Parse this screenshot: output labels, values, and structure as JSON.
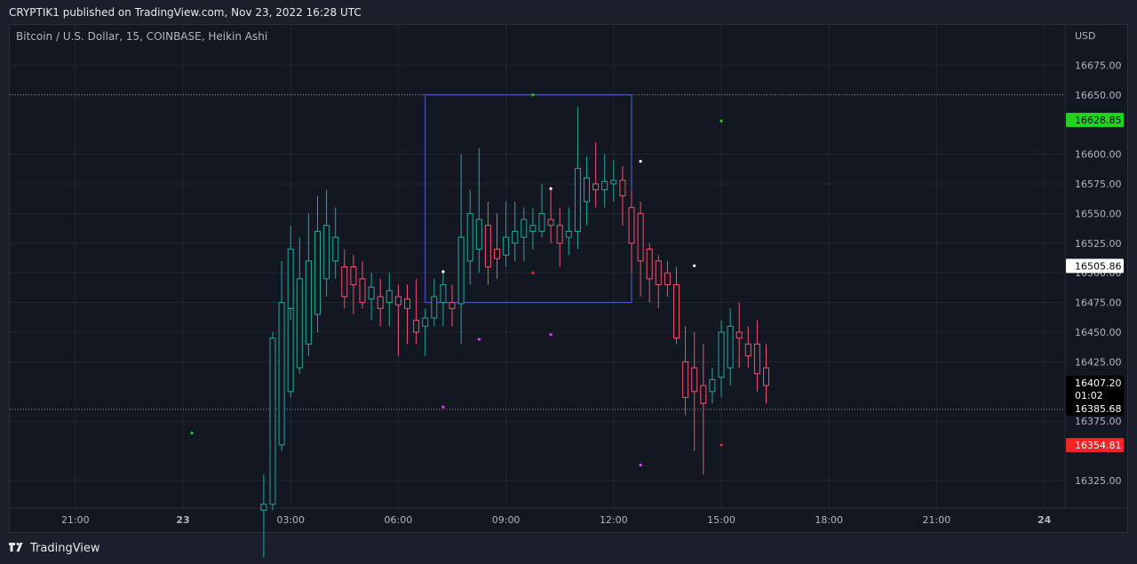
{
  "header": {
    "published": "CRYPTIK1 published on TradingView.com, Nov 23, 2022 16:28 UTC"
  },
  "symbol_label": "Bitcoin / U.S. Dollar, 15, COINBASE, Heikin Ashi",
  "footer": {
    "brand": "TradingView",
    "logo_icon": "tradingview-logo-icon"
  },
  "colors": {
    "background": "#131722",
    "grid": "#22262f",
    "up": "#26a69a",
    "down": "#ef5370",
    "box": "#4c64d8",
    "dotted_line": "#8a8fa0",
    "green_tag": "#1fd31f",
    "red_tag": "#f02525",
    "white_tag": "#ffffff",
    "dark_tag": "#000000"
  },
  "chart_data": {
    "type": "candlestick",
    "style": "Heikin Ashi",
    "currency": "USD",
    "ylim": [
      16300,
      16700
    ],
    "y_ticks": [
      "16325.00",
      "16375.00",
      "16425.00",
      "16450.00",
      "16475.00",
      "16500.00",
      "16525.00",
      "16550.00",
      "16575.00",
      "16600.00",
      "16650.00",
      "16675.00"
    ],
    "x_ticks": [
      {
        "label": "21:00",
        "hour": -3
      },
      {
        "label": "23",
        "hour": 0,
        "bold": true
      },
      {
        "label": "03:00",
        "hour": 3
      },
      {
        "label": "06:00",
        "hour": 6
      },
      {
        "label": "09:00",
        "hour": 9
      },
      {
        "label": "12:00",
        "hour": 12
      },
      {
        "label": "15:00",
        "hour": 15
      },
      {
        "label": "18:00",
        "hour": 18
      },
      {
        "label": "21:00",
        "hour": 21
      },
      {
        "label": "24",
        "hour": 24,
        "bold": true
      }
    ],
    "candles": [
      [
        "2:15",
        16300,
        16330,
        16260,
        16305
      ],
      [
        "2:30",
        16305,
        16450,
        16300,
        16445
      ],
      [
        "2:45",
        16355,
        16510,
        16350,
        16475
      ],
      [
        "3:00",
        16400,
        16490,
        16395,
        16470
      ],
      [
        "3:15",
        16420,
        16530,
        16415,
        16495
      ],
      [
        "3:30",
        16440,
        16550,
        16430,
        16510
      ],
      [
        "3:45",
        16465,
        16565,
        16450,
        16535
      ],
      [
        "3:00",
        16470,
        16540,
        16460,
        16520
      ],
      [
        "4:00",
        16495,
        16570,
        16480,
        16540
      ],
      [
        "4:15",
        16510,
        16555,
        16495,
        16530
      ],
      [
        "4:30",
        16505,
        16520,
        16470,
        16480
      ],
      [
        "4:45",
        16505,
        16515,
        16465,
        16490
      ],
      [
        "5:00",
        16495,
        16510,
        16470,
        16475
      ],
      [
        "5:15",
        16478,
        16500,
        16460,
        16488
      ],
      [
        "5:30",
        16480,
        16495,
        16455,
        16470
      ],
      [
        "5:45",
        16475,
        16500,
        16455,
        16485
      ],
      [
        "6:00",
        16480,
        16490,
        16430,
        16473
      ],
      [
        "6:15",
        16478,
        16490,
        16440,
        16470
      ],
      [
        "6:30",
        16460,
        16495,
        16440,
        16450
      ],
      [
        "6:45",
        16455,
        16470,
        16430,
        16462
      ],
      [
        "7:00",
        16462,
        16495,
        16455,
        16480
      ],
      [
        "7:15",
        16475,
        16500,
        16455,
        16490
      ],
      [
        "7:30",
        16475,
        16490,
        16455,
        16470
      ],
      [
        "7:45",
        16474,
        16600,
        16440,
        16530
      ],
      [
        "8:00",
        16510,
        16570,
        16490,
        16550
      ],
      [
        "8:15",
        16520,
        16605,
        16500,
        16545
      ],
      [
        "8:30",
        16540,
        16560,
        16490,
        16505
      ],
      [
        "8:45",
        16520,
        16550,
        16495,
        16512
      ],
      [
        "9:00",
        16515,
        16560,
        16505,
        16530
      ],
      [
        "9:15",
        16525,
        16560,
        16510,
        16535
      ],
      [
        "9:30",
        16530,
        16555,
        16510,
        16545
      ],
      [
        "9:45",
        16535,
        16555,
        16520,
        16540
      ],
      [
        "10:00",
        16535,
        16575,
        16530,
        16550
      ],
      [
        "10:15",
        16545,
        16570,
        16525,
        16540
      ],
      [
        "10:30",
        16540,
        16555,
        16505,
        16525
      ],
      [
        "10:45",
        16530,
        16555,
        16515,
        16535
      ],
      [
        "11:00",
        16535,
        16640,
        16520,
        16588
      ],
      [
        "11:15",
        16560,
        16598,
        16540,
        16580
      ],
      [
        "11:30",
        16575,
        16610,
        16555,
        16570
      ],
      [
        "11:45",
        16570,
        16600,
        16555,
        16577
      ],
      [
        "12:00",
        16575,
        16595,
        16560,
        16578
      ],
      [
        "12:15",
        16578,
        16590,
        16540,
        16565
      ],
      [
        "12:30",
        16555,
        16570,
        16500,
        16525
      ],
      [
        "12:45",
        16550,
        16560,
        16480,
        16510
      ],
      [
        "13:00",
        16520,
        16525,
        16475,
        16495
      ],
      [
        "13:15",
        16510,
        16515,
        16470,
        16490
      ],
      [
        "13:30",
        16500,
        16510,
        16480,
        16490
      ],
      [
        "13:45",
        16490,
        16505,
        16440,
        16445
      ],
      [
        "14:00",
        16425,
        16455,
        16380,
        16395
      ],
      [
        "14:15",
        16420,
        16450,
        16350,
        16400
      ],
      [
        "14:30",
        16405,
        16440,
        16330,
        16390
      ],
      [
        "14:45",
        16400,
        16420,
        16390,
        16410
      ],
      [
        "15:00",
        16412,
        16460,
        16395,
        16450
      ],
      [
        "15:15",
        16420,
        16470,
        16405,
        16455
      ],
      [
        "15:30",
        16450,
        16475,
        16420,
        16445
      ],
      [
        "15:45",
        16440,
        16455,
        16420,
        16430
      ],
      [
        "16:00",
        16440,
        16460,
        16400,
        16415
      ],
      [
        "16:15",
        16420,
        16440,
        16390,
        16405
      ]
    ],
    "markers": [
      {
        "hour": 0.25,
        "price": 16365,
        "color": "green"
      },
      {
        "hour": 7.25,
        "price": 16501,
        "color": "white"
      },
      {
        "hour": 7.25,
        "price": 16387,
        "color": "magenta"
      },
      {
        "hour": 8.25,
        "price": 16444,
        "color": "magenta"
      },
      {
        "hour": 9.75,
        "price": 16650,
        "color": "green"
      },
      {
        "hour": 9.75,
        "price": 16500,
        "color": "red"
      },
      {
        "hour": 10.25,
        "price": 16571,
        "color": "white"
      },
      {
        "hour": 10.25,
        "price": 16448,
        "color": "magenta"
      },
      {
        "hour": 12.75,
        "price": 16594,
        "color": "white"
      },
      {
        "hour": 12.75,
        "price": 16338,
        "color": "magenta"
      },
      {
        "hour": 14.25,
        "price": 16506,
        "color": "white"
      },
      {
        "hour": 15.0,
        "price": 16628,
        "color": "green"
      },
      {
        "hour": 15.0,
        "price": 16355,
        "color": "red"
      }
    ],
    "box": {
      "from_hour": 6.75,
      "to_hour": 12.5,
      "top": 16650,
      "bottom": 16475
    },
    "dotted_lines": [
      16650,
      16385
    ],
    "price_tags": [
      {
        "value": "16628.85",
        "price": 16628.85,
        "style": "green"
      },
      {
        "value": "16505.86",
        "price": 16505.86,
        "style": "white"
      },
      {
        "value": "16407.20",
        "sub": "01:02",
        "price": 16407.2,
        "style": "dark"
      },
      {
        "value": "16385.68",
        "price": 16385.68,
        "style": "dark"
      },
      {
        "value": "16354.81",
        "price": 16354.81,
        "style": "red"
      }
    ]
  }
}
